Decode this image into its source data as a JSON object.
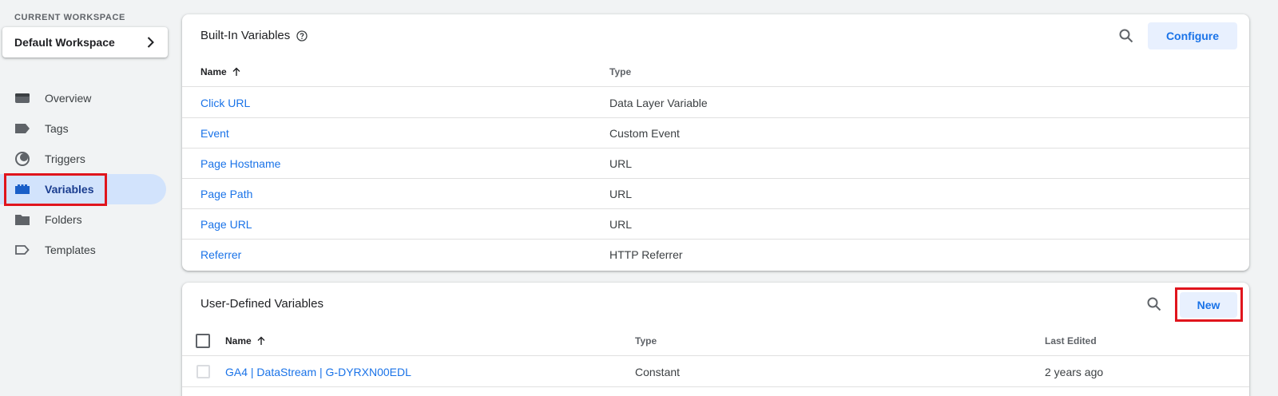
{
  "workspace": {
    "label": "CURRENT WORKSPACE",
    "name": "Default Workspace"
  },
  "nav": {
    "items": [
      {
        "label": "Overview",
        "icon": "overview-icon"
      },
      {
        "label": "Tags",
        "icon": "tag-icon"
      },
      {
        "label": "Triggers",
        "icon": "trigger-icon"
      },
      {
        "label": "Variables",
        "icon": "variables-icon",
        "active": true
      },
      {
        "label": "Folders",
        "icon": "folder-icon"
      },
      {
        "label": "Templates",
        "icon": "template-icon"
      }
    ]
  },
  "builtin": {
    "title": "Built-In Variables",
    "configure_label": "Configure",
    "columns": {
      "name": "Name",
      "type": "Type"
    },
    "rows": [
      {
        "name": "Click URL",
        "type": "Data Layer Variable"
      },
      {
        "name": "Event",
        "type": "Custom Event"
      },
      {
        "name": "Page Hostname",
        "type": "URL"
      },
      {
        "name": "Page Path",
        "type": "URL"
      },
      {
        "name": "Page URL",
        "type": "URL"
      },
      {
        "name": "Referrer",
        "type": "HTTP Referrer"
      }
    ]
  },
  "userdefined": {
    "title": "User-Defined Variables",
    "new_label": "New",
    "columns": {
      "name": "Name",
      "type": "Type",
      "edited": "Last Edited"
    },
    "rows": [
      {
        "name": "GA4 | DataStream | G-DYRXN00EDL",
        "type": "Constant",
        "edited": "2 years ago"
      }
    ]
  },
  "colors": {
    "accent": "#1a73e8",
    "active_nav_bg": "#d2e3fc",
    "highlight": "#e0151d"
  }
}
